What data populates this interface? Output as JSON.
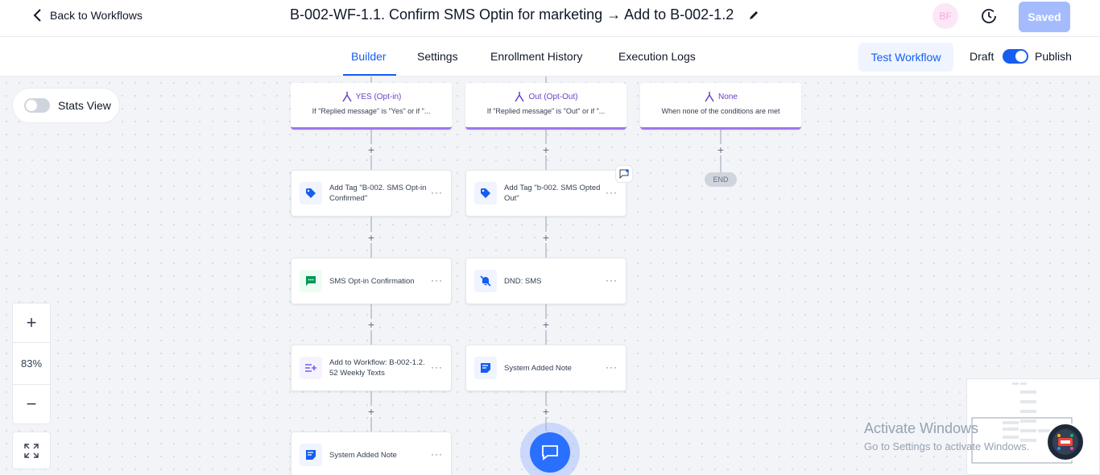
{
  "header": {
    "back_label": "Back to Workflows",
    "title": "B-002-WF-1.1. Confirm SMS Optin for marketing → Add to B-002-1.2",
    "avatar_initials": "BF",
    "saved_label": "Saved"
  },
  "tabs": [
    {
      "label": "Builder",
      "active": true
    },
    {
      "label": "Settings",
      "active": false
    },
    {
      "label": "Enrollment History",
      "active": false
    },
    {
      "label": "Execution Logs",
      "active": false
    }
  ],
  "actions": {
    "test_workflow_label": "Test Workflow",
    "draft_label": "Draft",
    "publish_label": "Publish",
    "publish_toggle_on": true
  },
  "canvas": {
    "stats_view_label": "Stats View",
    "zoom_level": "83%",
    "end_label": "END",
    "branches": [
      {
        "title": "YES (Opt-in)",
        "desc": "If \"Replied message\" is \"Yes\" or if \"..."
      },
      {
        "title": "Out (Opt-Out)",
        "desc": "If \"Replied message\" is \"Out\" or if \"..."
      },
      {
        "title": "None",
        "desc": "When none of the conditions are met"
      }
    ],
    "left_nodes": [
      {
        "label": "Add Tag \"B-002. SMS Opt-in Confirmed\"",
        "icon": "tag-icon"
      },
      {
        "label": "SMS Opt-in Confirmation",
        "icon": "sms-icon"
      },
      {
        "label": "Add to Workflow: B-002-1.2. 52 Weekly Texts",
        "icon": "add-to-workflow-icon"
      },
      {
        "label": "System Added Note",
        "icon": "note-icon"
      }
    ],
    "middle_nodes": [
      {
        "label": "Add Tag \"b-002. SMS Opted Out\"",
        "icon": "tag-icon"
      },
      {
        "label": "DND: SMS",
        "icon": "bell-off-icon"
      },
      {
        "label": "System Added Note",
        "icon": "note-icon"
      }
    ]
  },
  "watermark": {
    "line1": "Activate Windows",
    "line2": "Go to Settings to activate Windows."
  },
  "colors": {
    "primary": "#155eef",
    "branch_accent": "#9e77ed",
    "saved_button": "#a4bcfd"
  }
}
